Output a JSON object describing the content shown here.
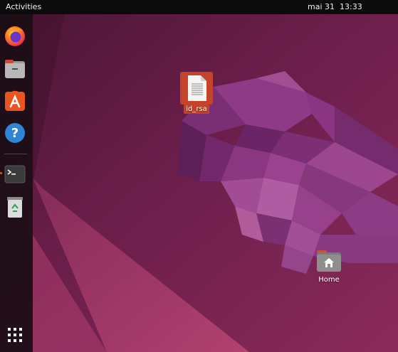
{
  "topbar": {
    "activities_label": "Activities",
    "date": "mai 31",
    "time": "13:33"
  },
  "dock": {
    "items": [
      {
        "name": "firefox",
        "icon": "firefox-icon",
        "running": false
      },
      {
        "name": "files",
        "icon": "files-icon",
        "running": false
      },
      {
        "name": "app-center",
        "icon": "app-store-icon",
        "running": false
      },
      {
        "name": "help",
        "icon": "help-icon",
        "running": false
      },
      {
        "name": "terminal",
        "icon": "terminal-icon",
        "running": true
      },
      {
        "name": "trash",
        "icon": "trash-icon",
        "running": false
      },
      {
        "name": "show-apps",
        "icon": "app-grid-icon",
        "running": false
      }
    ]
  },
  "desktop": {
    "file_icon": {
      "label": "id_rsa",
      "icon": "text-file-icon",
      "selected": true
    },
    "home_icon": {
      "label": "Home",
      "icon": "home-folder-icon"
    }
  },
  "colors": {
    "accent": "#e95420",
    "topbar": "#0b0b0b",
    "selection": "#c4432a"
  }
}
